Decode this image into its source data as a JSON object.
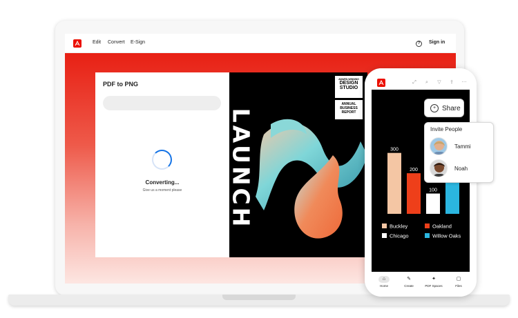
{
  "app": {
    "nav": [
      "Edit",
      "Convert",
      "E-Sign"
    ],
    "help_icon": "question-icon",
    "signin": "Sign in"
  },
  "converter": {
    "title": "PDF to PNG",
    "status": "Converting...",
    "status_sub": "Give us a moment please"
  },
  "poster": {
    "launch": "LAUNCH",
    "badge1": {
      "small": "AWARD-WINNING",
      "line1": "DESIGN",
      "line2": "STUDIO"
    },
    "badge2": {
      "line1": "ANNUAL",
      "line2": "BUSINESS",
      "line3": "REPORT"
    }
  },
  "phone": {
    "tabs": [
      {
        "label": "Home",
        "icon": "home-icon"
      },
      {
        "label": "Create",
        "icon": "create-icon"
      },
      {
        "label": "PDF Spaces",
        "icon": "spaces-icon"
      },
      {
        "label": "Files",
        "icon": "files-icon"
      }
    ]
  },
  "share": {
    "button": "Share",
    "invite_title": "Invite People",
    "people": [
      "Tammi",
      "Noah"
    ]
  },
  "chart_data": {
    "type": "bar",
    "title": "",
    "xlabel": "",
    "ylabel": "",
    "categories": [
      "Buckley",
      "Oakland",
      "Chicago",
      "Willow Oaks"
    ],
    "values": [
      300,
      200,
      100,
      300
    ],
    "labels_shown": [
      "300",
      "200",
      "100",
      null
    ],
    "ylim": [
      0,
      360
    ],
    "colors": [
      "#f4c6a4",
      "#ee3f1a",
      "#ffffff",
      "#2bb6e0"
    ],
    "legend": "bottom"
  },
  "colors": {
    "brand": "#eb1000",
    "accent": "#1473e6"
  }
}
